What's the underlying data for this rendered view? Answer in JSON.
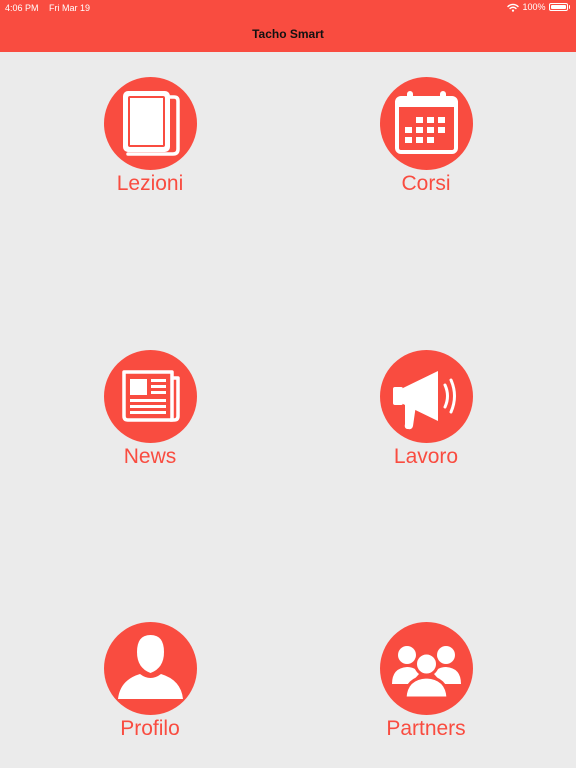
{
  "status_bar": {
    "time": "4:06 PM",
    "date": "Fri Mar 19",
    "battery": "100%",
    "battery_level": 1.0
  },
  "header": {
    "title": "Tacho Smart"
  },
  "colors": {
    "accent": "#f94c40",
    "background": "#ebebeb"
  },
  "menu": {
    "items": [
      {
        "label": "Lezioni",
        "icon": "book-icon"
      },
      {
        "label": "Corsi",
        "icon": "calendar-icon"
      },
      {
        "label": "News",
        "icon": "newspaper-icon"
      },
      {
        "label": "Lavoro",
        "icon": "megaphone-icon"
      },
      {
        "label": "Profilo",
        "icon": "user-icon"
      },
      {
        "label": "Partners",
        "icon": "group-icon"
      }
    ]
  }
}
